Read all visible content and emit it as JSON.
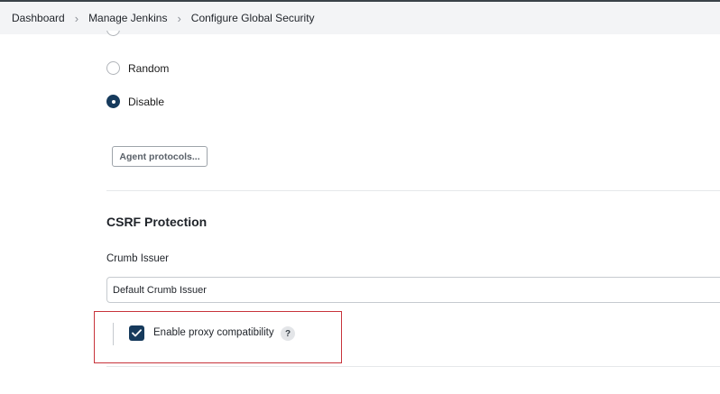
{
  "breadcrumb": {
    "items": [
      "Dashboard",
      "Manage Jenkins",
      "Configure Global Security"
    ],
    "separator": ">"
  },
  "agent_port": {
    "options": [
      {
        "label": "Random",
        "checked": false
      },
      {
        "label": "Disable",
        "checked": true
      }
    ],
    "protocols_button": "Agent protocols..."
  },
  "csrf": {
    "section_title": "CSRF Protection",
    "crumb_issuer_label": "Crumb Issuer",
    "crumb_issuer_value": "Default Crumb Issuer",
    "proxy_compat_label": "Enable proxy compatibility",
    "proxy_compat_checked": true,
    "help_text": "?"
  },
  "colors": {
    "accent": "#163a5c",
    "highlight": "#c8333b",
    "breadcrumb_bg": "#f3f4f6"
  }
}
